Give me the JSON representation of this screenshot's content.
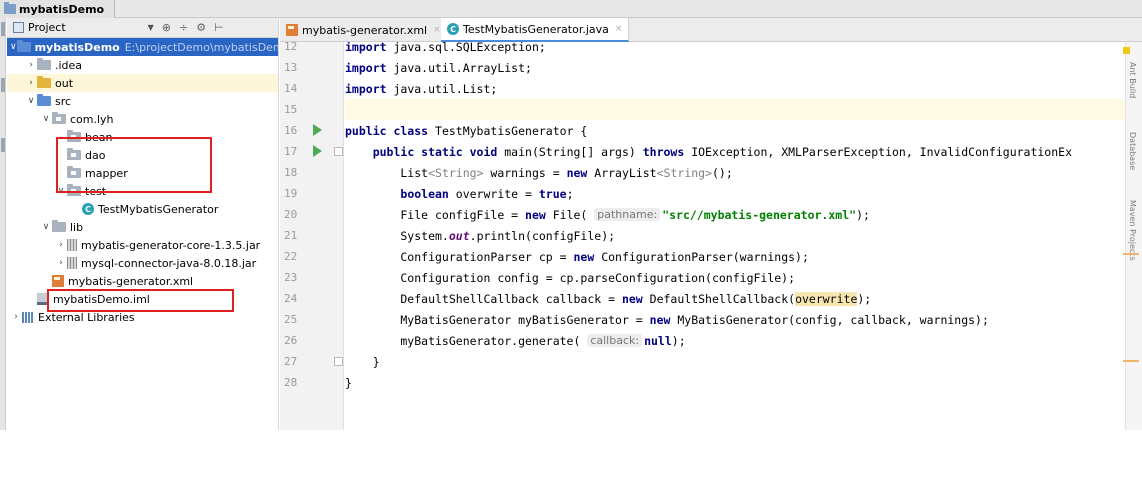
{
  "breadcrumb": {
    "project": "mybatisDemo"
  },
  "project_panel": {
    "title": "Project",
    "header_icons": [
      "caret-down-icon",
      "target-icon",
      "collapse-icon",
      "gear-icon",
      "pin-icon"
    ]
  },
  "tree": [
    {
      "label": "mybatisDemo",
      "path": "E:\\projectDemo\\mybatisDem",
      "depth": 0,
      "arrow": "down",
      "icon": "module-folder-icon",
      "selected": true
    },
    {
      "label": ".idea",
      "depth": 1,
      "arrow": "right",
      "icon": "folder-icon"
    },
    {
      "label": "out",
      "depth": 1,
      "arrow": "right",
      "icon": "output-folder-icon",
      "highlighted": true
    },
    {
      "label": "src",
      "depth": 1,
      "arrow": "down",
      "icon": "source-folder-icon"
    },
    {
      "label": "com.lyh",
      "depth": 2,
      "arrow": "down",
      "icon": "package-icon"
    },
    {
      "label": "bean",
      "depth": 3,
      "icon": "package-icon"
    },
    {
      "label": "dao",
      "depth": 3,
      "icon": "package-icon"
    },
    {
      "label": "mapper",
      "depth": 3,
      "icon": "package-icon"
    },
    {
      "label": "test",
      "depth": 3,
      "arrow": "down",
      "icon": "package-icon"
    },
    {
      "label": "TestMybatisGenerator",
      "depth": 4,
      "icon": "java-class-icon"
    },
    {
      "label": "lib",
      "depth": 2,
      "arrow": "down",
      "icon": "folder-icon"
    },
    {
      "label": "mybatis-generator-core-1.3.5.jar",
      "depth": 3,
      "arrow": "right",
      "icon": "jar-icon"
    },
    {
      "label": "mysql-connector-java-8.0.18.jar",
      "depth": 3,
      "arrow": "right",
      "icon": "jar-icon"
    },
    {
      "label": "mybatis-generator.xml",
      "depth": 2,
      "icon": "xml-file-icon"
    },
    {
      "label": "mybatisDemo.iml",
      "depth": 1,
      "icon": "iml-file-icon"
    },
    {
      "label": "External Libraries",
      "depth": 0,
      "arrow": "right",
      "icon": "libraries-icon"
    }
  ],
  "tabs": [
    {
      "label": "mybatis-generator.xml",
      "icon": "xml-file-icon",
      "active": false,
      "close": "×"
    },
    {
      "label": "TestMybatisGenerator.java",
      "icon": "java-class-icon",
      "active": true,
      "close": "×"
    }
  ],
  "class_icon_letter": "C",
  "editor": {
    "lines": [
      {
        "n": "12",
        "parts": [
          [
            "kw",
            "import"
          ],
          [
            "t",
            " java.sql.SQLException;"
          ]
        ]
      },
      {
        "n": "13",
        "parts": [
          [
            "kw",
            "import"
          ],
          [
            "t",
            " java.util.ArrayList;"
          ]
        ]
      },
      {
        "n": "14",
        "parts": [
          [
            "kw",
            "import"
          ],
          [
            "t",
            " java.util.List;"
          ]
        ]
      },
      {
        "n": "15",
        "parts": [],
        "current": true
      },
      {
        "n": "16",
        "parts": [
          [
            "kw",
            "public class"
          ],
          [
            "t",
            " TestMybatisGenerator {"
          ]
        ],
        "run": true
      },
      {
        "n": "17",
        "parts": [
          [
            "t",
            "    "
          ],
          [
            "kw",
            "public static void"
          ],
          [
            "t",
            " main(String[] args) "
          ],
          [
            "kw",
            "throws"
          ],
          [
            "t",
            " IOException, XMLParserException, InvalidConfigurationEx"
          ]
        ],
        "run": true,
        "fold": true
      },
      {
        "n": "18",
        "parts": [
          [
            "t",
            "        List"
          ],
          [
            "gen",
            "<String>"
          ],
          [
            "t",
            " warnings = "
          ],
          [
            "kw",
            "new"
          ],
          [
            "t",
            " ArrayList"
          ],
          [
            "gen",
            "<String>"
          ],
          [
            "t",
            "();"
          ]
        ]
      },
      {
        "n": "19",
        "parts": [
          [
            "t",
            "        "
          ],
          [
            "kw",
            "boolean"
          ],
          [
            "t",
            " overwrite = "
          ],
          [
            "kw",
            "true"
          ],
          [
            "t",
            ";"
          ]
        ]
      },
      {
        "n": "20",
        "parts": [
          [
            "t",
            "        File configFile = "
          ],
          [
            "kw",
            "new"
          ],
          [
            "t",
            " File( "
          ],
          [
            "hint",
            "pathname:"
          ],
          [
            "str",
            "\"src//mybatis-generator.xml\""
          ],
          [
            "t",
            ");"
          ]
        ]
      },
      {
        "n": "21",
        "parts": [
          [
            "t",
            "        System."
          ],
          [
            "fld",
            "out"
          ],
          [
            "t",
            ".println(configFile);"
          ]
        ]
      },
      {
        "n": "22",
        "parts": [
          [
            "t",
            "        ConfigurationParser cp = "
          ],
          [
            "kw",
            "new"
          ],
          [
            "t",
            " ConfigurationParser(warnings);"
          ]
        ]
      },
      {
        "n": "23",
        "parts": [
          [
            "t",
            "        Configuration config = cp.parseConfiguration(configFile);"
          ]
        ]
      },
      {
        "n": "24",
        "parts": [
          [
            "t",
            "        DefaultShellCallback callback = "
          ],
          [
            "kw",
            "new"
          ],
          [
            "t",
            " DefaultShellCallback("
          ],
          [
            "mark",
            "overwrite"
          ],
          [
            "t",
            ");"
          ]
        ]
      },
      {
        "n": "25",
        "parts": [
          [
            "t",
            "        MyBatisGenerator myBatisGenerator = "
          ],
          [
            "kw",
            "new"
          ],
          [
            "t",
            " MyBatisGenerator(config, callback, warnings);"
          ]
        ]
      },
      {
        "n": "26",
        "parts": [
          [
            "t",
            "        myBatisGenerator.generate( "
          ],
          [
            "hint",
            "callback:"
          ],
          [
            "kw",
            "null"
          ],
          [
            "t",
            ");"
          ]
        ]
      },
      {
        "n": "27",
        "parts": [
          [
            "t",
            "    }"
          ]
        ],
        "fold": true
      },
      {
        "n": "28",
        "parts": [
          [
            "t",
            "}"
          ]
        ]
      }
    ]
  },
  "right_strip": [
    "Ant Build",
    "Database",
    "Maven Projects"
  ],
  "colors": {
    "selection": "#2a65c4",
    "annotation_red": "#e0201e",
    "keyword": "#000080",
    "string": "#008000",
    "run_green": "#4caa54"
  }
}
